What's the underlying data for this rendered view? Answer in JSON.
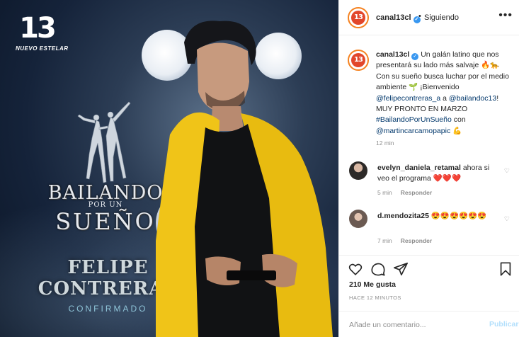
{
  "media": {
    "logo_number": "13",
    "logo_subtitle": "NUEVO ESTELAR",
    "show_title_line1": "BAILANDO",
    "show_title_line2": "POR UN",
    "show_title_line3": "SUEÑO",
    "name_line1": "FELIPE",
    "name_line2": "CONTRERAS",
    "status": "CONFIRMADO"
  },
  "header": {
    "avatar_text": "13",
    "username": "canal13cl",
    "separator": "•",
    "follow_label": "Siguiendo",
    "more_icon": "ellipsis-icon"
  },
  "caption": {
    "username": "canal13cl",
    "text_part1": "Un galán latino que nos presentará su lado más salvaje 🔥🐆 Con su sueño busca luchar por el medio ambiente 🌱 ¡Bienvenido",
    "mention1": "@felipecontreras_a",
    "text_part2": "a",
    "mention2": "@bailandoc13",
    "text_part3": "! MUY PRONTO EN MARZO",
    "hashtag": "#BailandoPorUnSueño",
    "text_part4": "con",
    "mention3": "@martincarcamopapic",
    "text_part5": "💪",
    "time": "12 min"
  },
  "comments": [
    {
      "username": "evelyn_daniela_retamal",
      "text": "ahora si veo el programa ❤️❤️❤️",
      "time": "5 min",
      "reply_label": "Responder"
    },
    {
      "username": "d.mendozita25",
      "text": "😍😍😍😍😍😍",
      "time": "7 min",
      "reply_label": "Responder"
    }
  ],
  "actions": {
    "likes": "210 Me gusta",
    "ago": "HACE 12 MINUTOS",
    "comment_placeholder": "Añade un comentario...",
    "post_label": "Publicar"
  },
  "colors": {
    "link": "#00376b",
    "verified": "#3897f0",
    "post_disabled": "#b2dffc",
    "brand_orange": "#f58220"
  }
}
